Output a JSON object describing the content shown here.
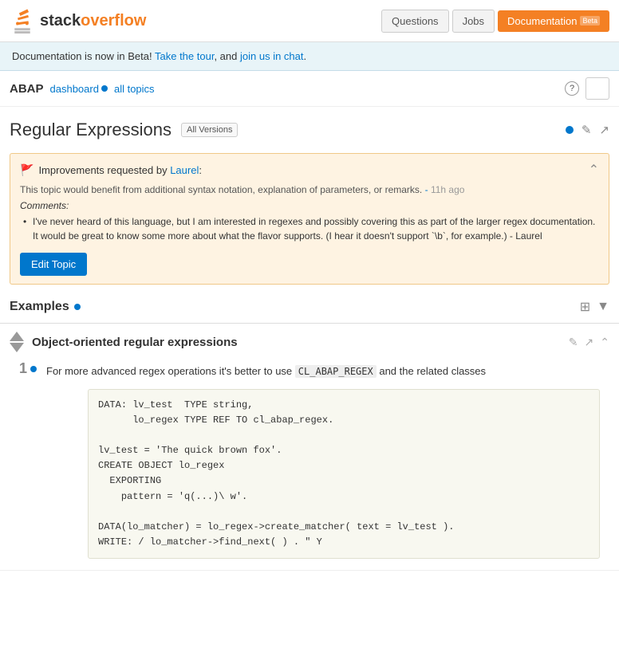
{
  "header": {
    "logo_text_start": "stack",
    "logo_text_end": "overflow",
    "nav": {
      "questions_label": "Questions",
      "jobs_label": "Jobs",
      "docs_label": "Documentation",
      "docs_badge": "Beta"
    }
  },
  "banner": {
    "text": "Documentation is now in Beta!",
    "tour_link": "Take the tour",
    "and_text": ", and",
    "chat_link": "join us in chat",
    "period": "."
  },
  "breadcrumb": {
    "abap": "ABAP",
    "dashboard_label": "dashboard",
    "all_topics_label": "all topics"
  },
  "topic": {
    "title": "Regular Expressions",
    "all_versions_label": "All Versions"
  },
  "improvements": {
    "header_text": "Improvements requested by",
    "author": "Laurel",
    "body": "This topic would benefit from additional syntax notation, explanation of parameters, or remarks.",
    "timestamp": "11h ago",
    "comments_label": "Comments:",
    "comment": "I've never heard of this language, but I am interested in regexes and possibly covering this as part of the larger regex documentation. It would be great to know some more about what the flavor supports. (I hear it doesn't support `\\b`, for example.) - Laurel",
    "edit_button_label": "Edit Topic"
  },
  "examples": {
    "title": "Examples",
    "items": [
      {
        "title": "Object-oriented regular expressions",
        "vote": "1",
        "description_pre": "For more advanced regex operations it's better to use",
        "code_inline": "CL_ABAP_REGEX",
        "description_post": "and the related classes",
        "code_block": "DATA: lv_test  TYPE string,\n      lo_regex TYPE REF TO cl_abap_regex.\n\nlv_test = 'The quick brown fox'.\nCREATE OBJECT lo_regex\n  EXPORTING\n    pattern = 'q(...)\\ w'.\n\nDATA(lo_matcher) = lo_regex->create_matcher( text = lv_test ).\nWRITE: / lo_matcher->find_next( ) . \" Y"
      }
    ]
  }
}
